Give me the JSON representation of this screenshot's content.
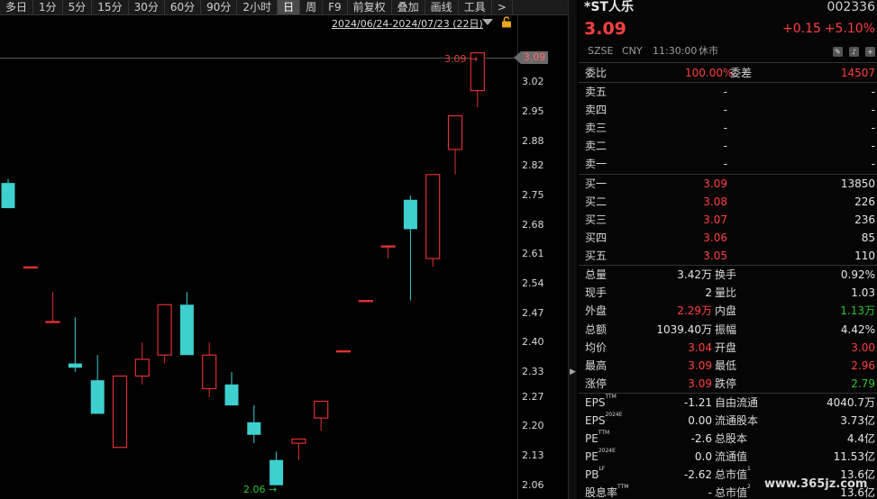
{
  "toolbar": {
    "items": [
      "多日",
      "1分",
      "5分",
      "15分",
      "30分",
      "60分",
      "90分",
      "2小时",
      "日",
      "周",
      "F9",
      "前复权",
      "叠加",
      "画线",
      "工具",
      ">"
    ],
    "active": "日"
  },
  "chart": {
    "range_label": "2024/06/24-2024/07/23 (22日)",
    "current_price_tag": "3.09",
    "high_label": "3.09",
    "low_label": "2.06",
    "y_ticks": [
      "3.02",
      "2.95",
      "2.88",
      "2.82",
      "2.75",
      "2.68",
      "2.61",
      "2.54",
      "2.47",
      "2.40",
      "2.33",
      "2.27",
      "2.20",
      "2.13",
      "2.06"
    ],
    "colors": {
      "up": "#e03030",
      "down": "#3ecfcf",
      "panel_bg": "#050505"
    }
  },
  "chart_data": {
    "type": "candlestick",
    "x_range": [
      "2024/06/24",
      "2024/07/23"
    ],
    "ylim": [
      2.04,
      3.1
    ],
    "candles": [
      {
        "o": 2.78,
        "h": 2.79,
        "l": 2.72,
        "c": 2.72
      },
      {
        "o": 2.58,
        "h": 2.58,
        "l": 2.58,
        "c": 2.58
      },
      {
        "o": 2.45,
        "h": 2.52,
        "l": 2.45,
        "c": 2.45
      },
      {
        "o": 2.35,
        "h": 2.46,
        "l": 2.33,
        "c": 2.34
      },
      {
        "o": 2.31,
        "h": 2.37,
        "l": 2.23,
        "c": 2.23
      },
      {
        "o": 2.15,
        "h": 2.32,
        "l": 2.15,
        "c": 2.32
      },
      {
        "o": 2.32,
        "h": 2.4,
        "l": 2.3,
        "c": 2.36
      },
      {
        "o": 2.37,
        "h": 2.49,
        "l": 2.35,
        "c": 2.49
      },
      {
        "o": 2.49,
        "h": 2.52,
        "l": 2.37,
        "c": 2.37
      },
      {
        "o": 2.29,
        "h": 2.4,
        "l": 2.27,
        "c": 2.37
      },
      {
        "o": 2.3,
        "h": 2.33,
        "l": 2.25,
        "c": 2.25
      },
      {
        "o": 2.21,
        "h": 2.25,
        "l": 2.16,
        "c": 2.18
      },
      {
        "o": 2.12,
        "h": 2.14,
        "l": 2.06,
        "c": 2.06
      },
      {
        "o": 2.16,
        "h": 2.17,
        "l": 2.12,
        "c": 2.17
      },
      {
        "o": 2.22,
        "h": 2.26,
        "l": 2.19,
        "c": 2.26
      },
      {
        "o": 2.38,
        "h": 2.38,
        "l": 2.38,
        "c": 2.38
      },
      {
        "o": 2.5,
        "h": 2.5,
        "l": 2.5,
        "c": 2.5
      },
      {
        "o": 2.63,
        "h": 2.63,
        "l": 2.6,
        "c": 2.63
      },
      {
        "o": 2.74,
        "h": 2.75,
        "l": 2.5,
        "c": 2.67
      },
      {
        "o": 2.6,
        "h": 2.8,
        "l": 2.58,
        "c": 2.8
      },
      {
        "o": 2.86,
        "h": 2.94,
        "l": 2.8,
        "c": 2.94
      },
      {
        "o": 3.0,
        "h": 3.09,
        "l": 2.96,
        "c": 3.09
      }
    ]
  },
  "quote": {
    "name": "*ST人乐",
    "code": "002336",
    "price": "3.09",
    "change": "+0.15",
    "change_pct": "+5.10%",
    "exchange": "SZSE",
    "currency": "CNY",
    "time": "11:30:00",
    "status": "休市",
    "wei_bi_label": "委比",
    "wei_bi": "100.00%",
    "wei_cha_label": "委差",
    "wei_cha": "14507",
    "asks": [
      {
        "label": "卖五",
        "price": "-",
        "vol": "-"
      },
      {
        "label": "卖四",
        "price": "-",
        "vol": "-"
      },
      {
        "label": "卖三",
        "price": "-",
        "vol": "-"
      },
      {
        "label": "卖二",
        "price": "-",
        "vol": "-"
      },
      {
        "label": "卖一",
        "price": "-",
        "vol": "-"
      }
    ],
    "bids": [
      {
        "label": "买一",
        "price": "3.09",
        "vol": "13850"
      },
      {
        "label": "买二",
        "price": "3.08",
        "vol": "226"
      },
      {
        "label": "买三",
        "price": "3.07",
        "vol": "236"
      },
      {
        "label": "买四",
        "price": "3.06",
        "vol": "85"
      },
      {
        "label": "买五",
        "price": "3.05",
        "vol": "110"
      }
    ],
    "stats": [
      {
        "l1": "总量",
        "v1": "3.42万",
        "c1": "white",
        "l2": "换手",
        "v2": "0.92%",
        "c2": "white"
      },
      {
        "l1": "现手",
        "v1": "2",
        "c1": "white",
        "l2": "量比",
        "v2": "1.03",
        "c2": "white"
      },
      {
        "l1": "外盘",
        "v1": "2.29万",
        "c1": "red",
        "l2": "内盘",
        "v2": "1.13万",
        "c2": "green"
      },
      {
        "l1": "总额",
        "v1": "1039.40万",
        "c1": "white",
        "l2": "振幅",
        "v2": "4.42%",
        "c2": "white"
      },
      {
        "l1": "均价",
        "v1": "3.04",
        "c1": "red",
        "l2": "开盘",
        "v2": "3.00",
        "c2": "red"
      },
      {
        "l1": "最高",
        "v1": "3.09",
        "c1": "red",
        "l2": "最低",
        "v2": "2.96",
        "c2": "red"
      },
      {
        "l1": "涨停",
        "v1": "3.09",
        "c1": "red",
        "l2": "跌停",
        "v2": "2.79",
        "c2": "green"
      }
    ],
    "fundamentals": [
      {
        "l1": "EPS",
        "s1": "TTM",
        "v1": "-1.21",
        "l2": "自由流通",
        "s2": "",
        "v2": "4040.7万"
      },
      {
        "l1": "EPS",
        "s1": "2024E",
        "v1": "0.00",
        "l2": "流通股本",
        "s2": "",
        "v2": "3.73亿"
      },
      {
        "l1": "PE",
        "s1": "TTM",
        "v1": "-2.6",
        "l2": "总股本",
        "s2": "",
        "v2": "4.4亿"
      },
      {
        "l1": "PE",
        "s1": "2024E",
        "v1": "0.0",
        "l2": "流通值",
        "s2": "",
        "v2": "11.53亿"
      },
      {
        "l1": "PB",
        "s1": "LF",
        "v1": "-2.62",
        "l2": "总市值",
        "s2": "1",
        "v2": "13.6亿"
      },
      {
        "l1": "股息率",
        "s1": "TTM",
        "v1": "-",
        "l2": "总市值",
        "s2": "2",
        "v2": "13.6亿"
      }
    ]
  },
  "watermark": "www.365jz.com"
}
